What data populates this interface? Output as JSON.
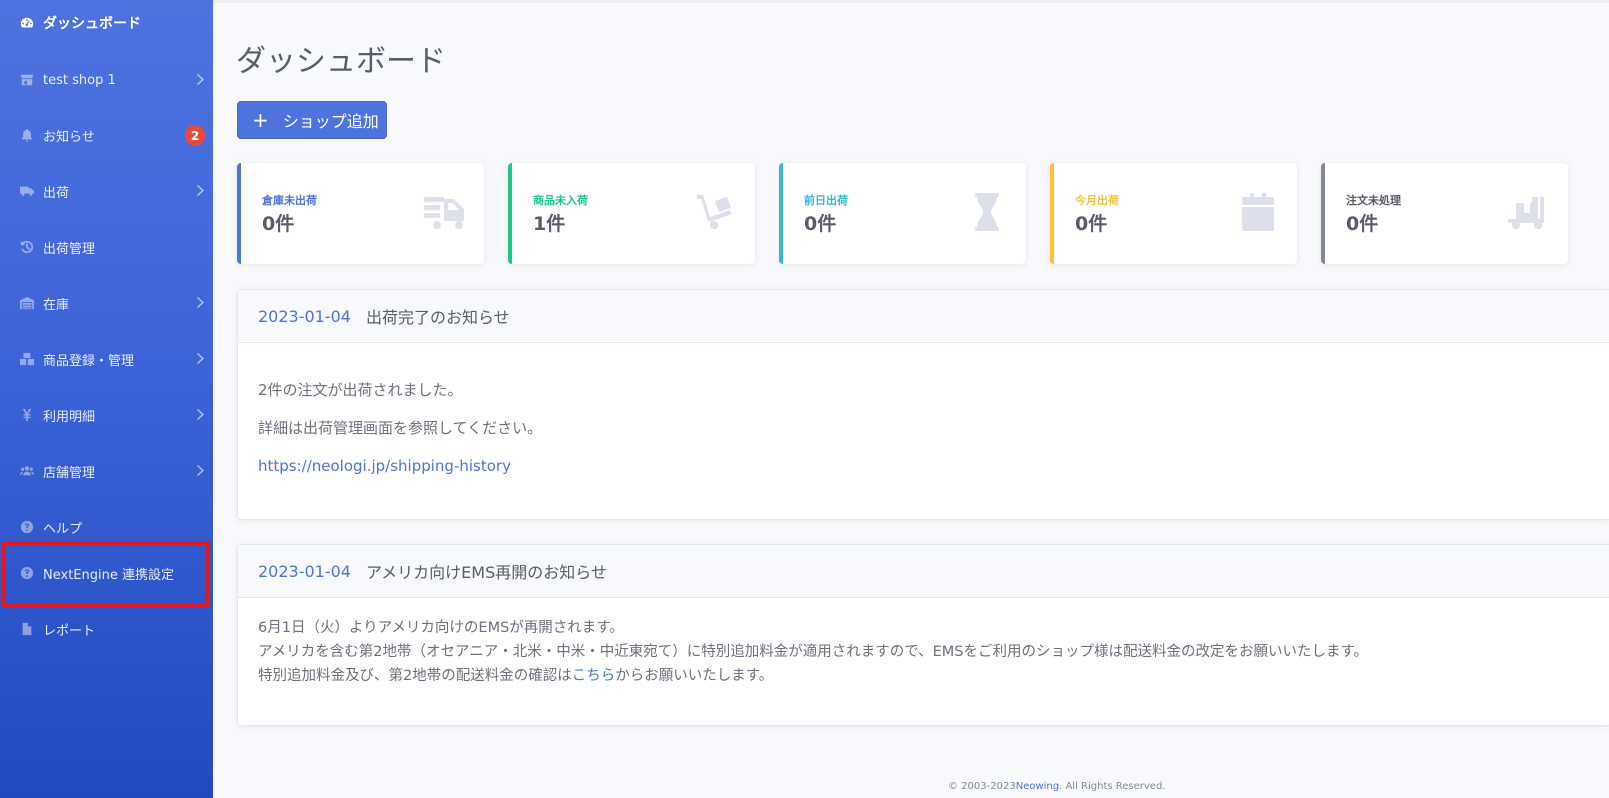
{
  "sidebar": {
    "brand": "ダッシュボード",
    "items": [
      {
        "label": "test shop 1"
      },
      {
        "label": "お知らせ",
        "badge": "2"
      },
      {
        "label": "出荷"
      },
      {
        "label": "出荷管理"
      },
      {
        "label": "在庫"
      },
      {
        "label": "商品登録・管理"
      },
      {
        "label": "利用明細"
      },
      {
        "label": "店舗管理"
      },
      {
        "label": "ヘルプ"
      },
      {
        "label": "NextEngine 連携設定"
      },
      {
        "label": "レポート"
      }
    ]
  },
  "main": {
    "title": "ダッシュボード",
    "add_shop_label": "ショップ追加",
    "cards": [
      {
        "label": "倉庫未出荷",
        "value": "0件",
        "color": "#4e73df",
        "icon": "truck-loading-icon"
      },
      {
        "label": "商品未入荷",
        "value": "1件",
        "color": "#1cc88a",
        "icon": "dolly-icon"
      },
      {
        "label": "前日出荷",
        "value": "0件",
        "color": "#36b9cc",
        "icon": "hourglass-icon"
      },
      {
        "label": "今月出荷",
        "value": "0件",
        "color": "#f6c23e",
        "icon": "calendar-icon"
      },
      {
        "label": "注文未処理",
        "value": "0件",
        "color": "#858796",
        "icon": "dolly-flatbed-icon"
      }
    ],
    "notices": [
      {
        "date": "2023-01-04",
        "title": "出荷完了のお知らせ",
        "line1": "2件の注文が出荷されました。",
        "line2": "詳細は出荷管理画面を参照してください。",
        "link": "https://neologi.jp/shipping-history"
      },
      {
        "date": "2023-01-04",
        "title": "アメリカ向けEMS再開のお知らせ",
        "line1": "6月1日（火）よりアメリカ向けのEMSが再開されます。",
        "line2": "アメリカを含む第2地帯（オセアニア・北米・中米・中近東宛て）に特別追加料金が適用されますので、EMSをご利用のショップ様は配送料金の改定をお願いいたします。",
        "line3_pre": "特別追加料金及び、第2地帯の配送料金の確認は",
        "line3_link": "こちら",
        "line3_post": "からお願いいたします。"
      }
    ]
  },
  "footer": {
    "copyright_pre": "© 2003-2023",
    "company": "Neowing",
    "copyright_post": ". All Rights Reserved."
  }
}
